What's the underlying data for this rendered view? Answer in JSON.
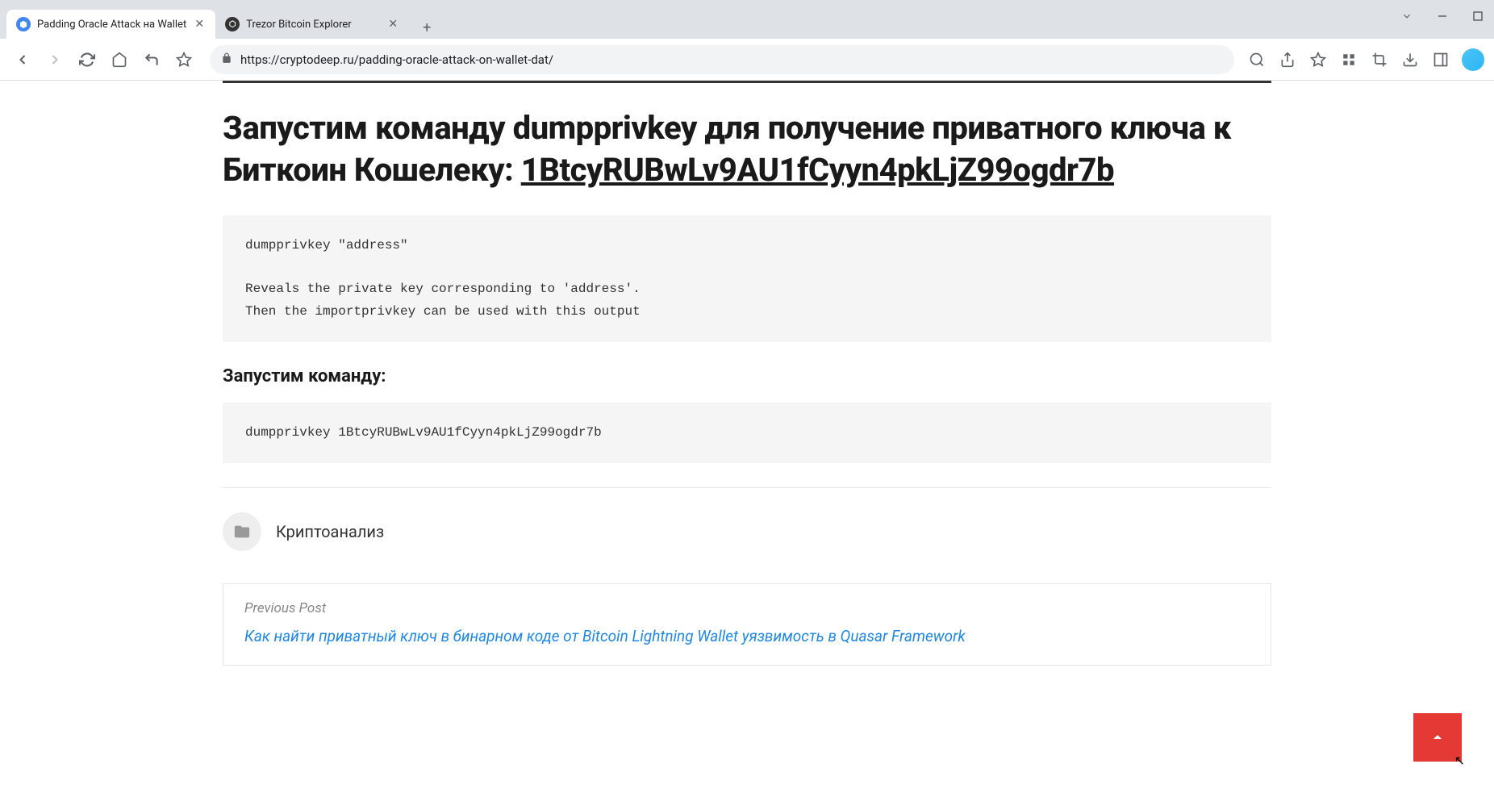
{
  "tabs": [
    {
      "title": "Padding Oracle Attack на Wallet",
      "active": true
    },
    {
      "title": "Trezor Bitcoin Explorer",
      "active": false
    }
  ],
  "url": "https://cryptodeep.ru/padding-oracle-attack-on-wallet-dat/",
  "heading_prefix": "Запустим команду dumpprivkey для получение приватного ключа к Биткоин Кошелеку: ",
  "heading_address": "1BtcyRUBwLv9AU1fCyyn4pkLjZ99ogdr7b",
  "code1": "dumpprivkey \"address\"\n\nReveals the private key corresponding to 'address'.\nThen the importprivkey can be used with this output",
  "subheading": "Запустим команду:",
  "code2": "dumpprivkey 1BtcyRUBwLv9AU1fCyyn4pkLjZ99ogdr7b",
  "category": "Криптоанализ",
  "prev_post_label": "Previous Post",
  "prev_post_title": "Как найти приватный ключ в бинарном коде от Bitcoin Lightning Wallet уязвимость в Quasar Framework"
}
